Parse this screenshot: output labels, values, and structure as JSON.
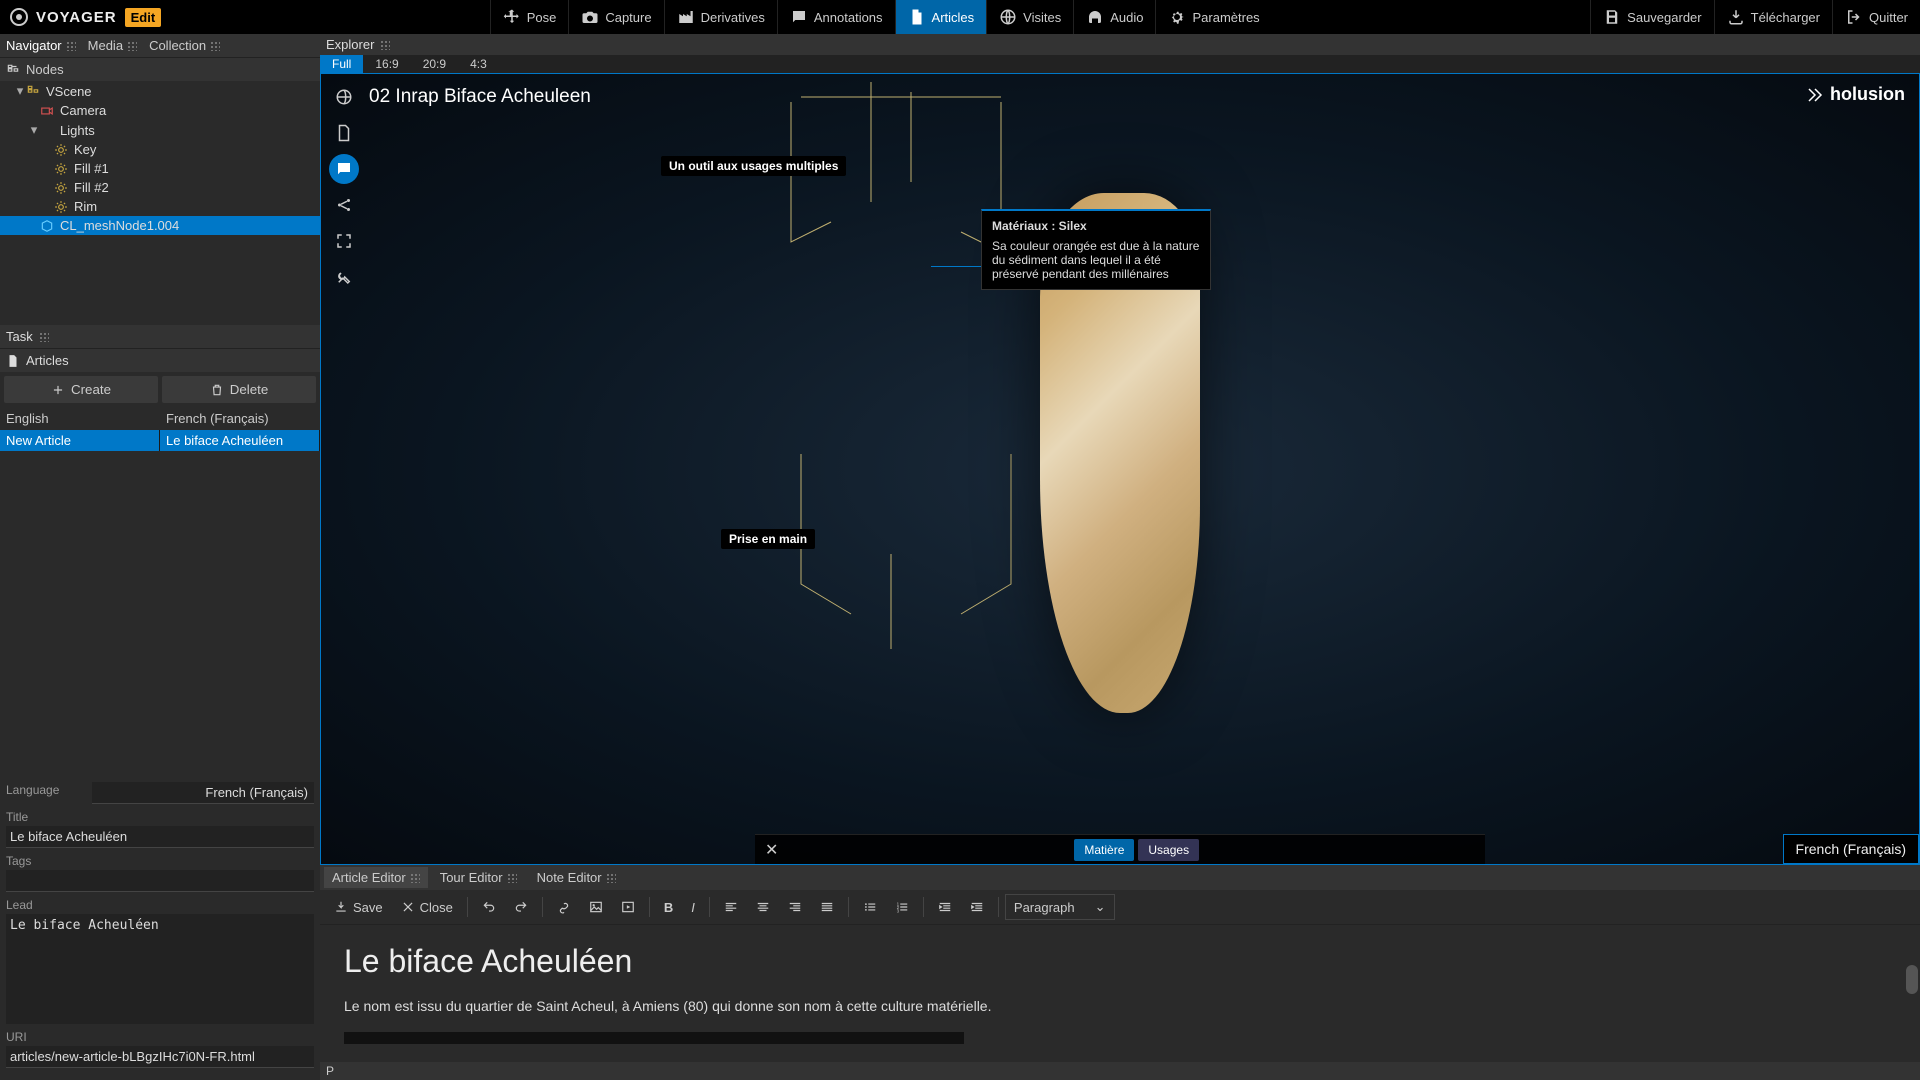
{
  "app": {
    "name": "VOYAGER",
    "badge": "Edit"
  },
  "topbar": {
    "tabs": [
      {
        "label": "Pose"
      },
      {
        "label": "Capture"
      },
      {
        "label": "Derivatives"
      },
      {
        "label": "Annotations"
      },
      {
        "label": "Articles"
      },
      {
        "label": "Visites"
      },
      {
        "label": "Audio"
      },
      {
        "label": "Paramètres"
      }
    ],
    "right": [
      {
        "label": "Sauvegarder"
      },
      {
        "label": "Télécharger"
      },
      {
        "label": "Quitter"
      }
    ]
  },
  "navigator": {
    "title": "Navigator",
    "tabs": {
      "media": "Media",
      "collection": "Collection"
    },
    "nodes_label": "Nodes",
    "tree": [
      {
        "label": "VScene",
        "depth": 1,
        "expand": "▾",
        "icon": "scene"
      },
      {
        "label": "Camera",
        "depth": 2,
        "expand": "",
        "icon": "camera"
      },
      {
        "label": "Lights",
        "depth": 2,
        "expand": "▾",
        "icon": ""
      },
      {
        "label": "Key",
        "depth": 3,
        "expand": "",
        "icon": "light"
      },
      {
        "label": "Fill #1",
        "depth": 3,
        "expand": "",
        "icon": "light"
      },
      {
        "label": "Fill #2",
        "depth": 3,
        "expand": "",
        "icon": "light"
      },
      {
        "label": "Rim",
        "depth": 3,
        "expand": "",
        "icon": "light"
      },
      {
        "label": "CL_meshNode1.004",
        "depth": 2,
        "expand": "",
        "icon": "mesh",
        "selected": true
      }
    ]
  },
  "task": {
    "title": "Task",
    "section": "Articles",
    "create": "Create",
    "delete": "Delete",
    "lang_en": "English",
    "lang_fr": "French (Français)",
    "article_en": "New Article",
    "article_fr": "Le biface Acheuléen"
  },
  "form": {
    "language_label": "Language",
    "language_value": "French (Français)",
    "title_label": "Title",
    "title_value": "Le biface Acheuléen",
    "tags_label": "Tags",
    "tags_value": "",
    "lead_label": "Lead",
    "lead_value": "Le biface Acheuléen",
    "uri_label": "URI",
    "uri_value": "articles/new-article-bLBgzIHc7i0N-FR.html"
  },
  "explorer": {
    "title": "Explorer",
    "aspects": [
      "Full",
      "16:9",
      "20:9",
      "4:3"
    ]
  },
  "viewport": {
    "title": "02 Inrap Biface Acheuleen",
    "brand": "holusion",
    "annotation_top": "Un outil aux usages multiples",
    "annotation_bottom": "Prise en main",
    "popup_title": "Matériaux : Silex",
    "popup_body": "Sa couleur orangée est due à la nature du sédiment dans lequel il a été préservé pendant des millénaires",
    "float_tab1": "Matière",
    "float_tab2": "Usages",
    "lang_indicator": "French (Français)"
  },
  "editor": {
    "tabs": [
      "Article Editor",
      "Tour Editor",
      "Note Editor"
    ],
    "save": "Save",
    "close": "Close",
    "para_style": "Paragraph",
    "heading": "Le biface Acheuléen",
    "body": "Le nom est issu du quartier de Saint Acheul, à Amiens (80) qui donne son nom à cette culture matérielle.",
    "status": "P"
  }
}
